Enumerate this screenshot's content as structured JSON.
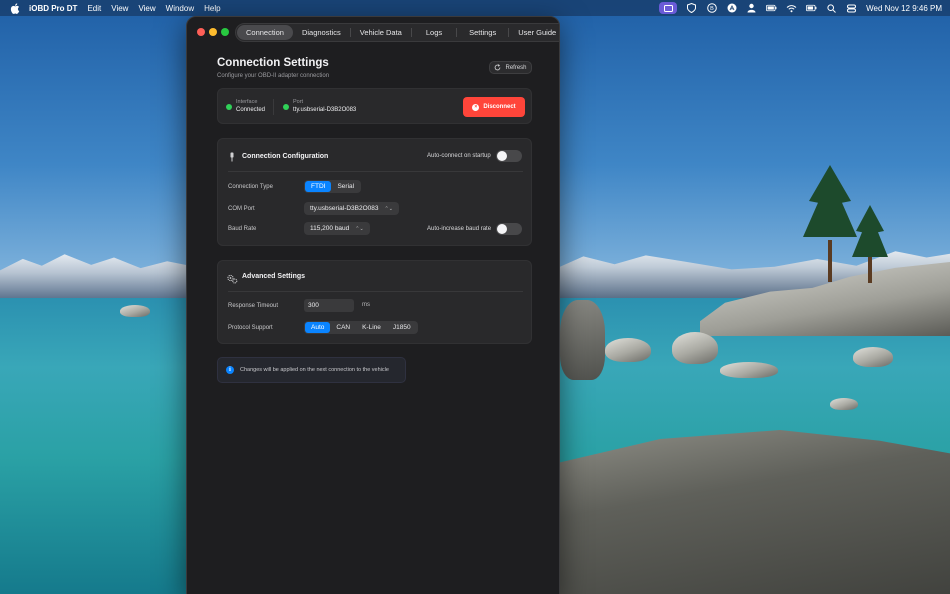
{
  "menubar": {
    "app_name": "iOBD Pro DT",
    "menus": [
      "Edit",
      "View",
      "View",
      "Window",
      "Help"
    ],
    "clock": "Wed Nov 12  9:46 PM"
  },
  "tabs": [
    "Connection",
    "Diagnostics",
    "Vehicle Data",
    "Logs",
    "Settings",
    "User Guide"
  ],
  "active_tab": "Connection",
  "header": {
    "title": "Connection Settings",
    "subtitle": "Configure your OBD-II adapter connection",
    "refresh_label": "Refresh"
  },
  "status": {
    "interface_label": "Interface",
    "interface_value": "Connected",
    "port_label": "Port",
    "port_value": "tty.usbserial-D3B2O083",
    "disconnect_label": "Disconnect",
    "indicator_color": "#30d158"
  },
  "connection_config": {
    "title": "Connection Configuration",
    "auto_connect_label": "Auto-connect on startup",
    "auto_connect_on": false,
    "connection_type_label": "Connection Type",
    "connection_types": [
      "FTDI",
      "Serial"
    ],
    "connection_type_selected": "FTDI",
    "com_port_label": "COM Port",
    "com_port_value": "tty.usbserial-D3B2O083",
    "baud_rate_label": "Baud Rate",
    "baud_rate_value": "115,200 baud",
    "auto_baud_label": "Auto-increase baud rate",
    "auto_baud_on": false
  },
  "advanced": {
    "title": "Advanced Settings",
    "timeout_label": "Response Timeout",
    "timeout_value": "300",
    "timeout_unit": "ms",
    "protocol_label": "Protocol Support",
    "protocols": [
      "Auto",
      "CAN",
      "K-Line",
      "J1850"
    ],
    "protocol_selected": "Auto"
  },
  "info_note": "Changes will be applied on the next connection to the vehicle",
  "colors": {
    "accent": "#0a84ff",
    "danger": "#ff453a",
    "success": "#30d158"
  }
}
